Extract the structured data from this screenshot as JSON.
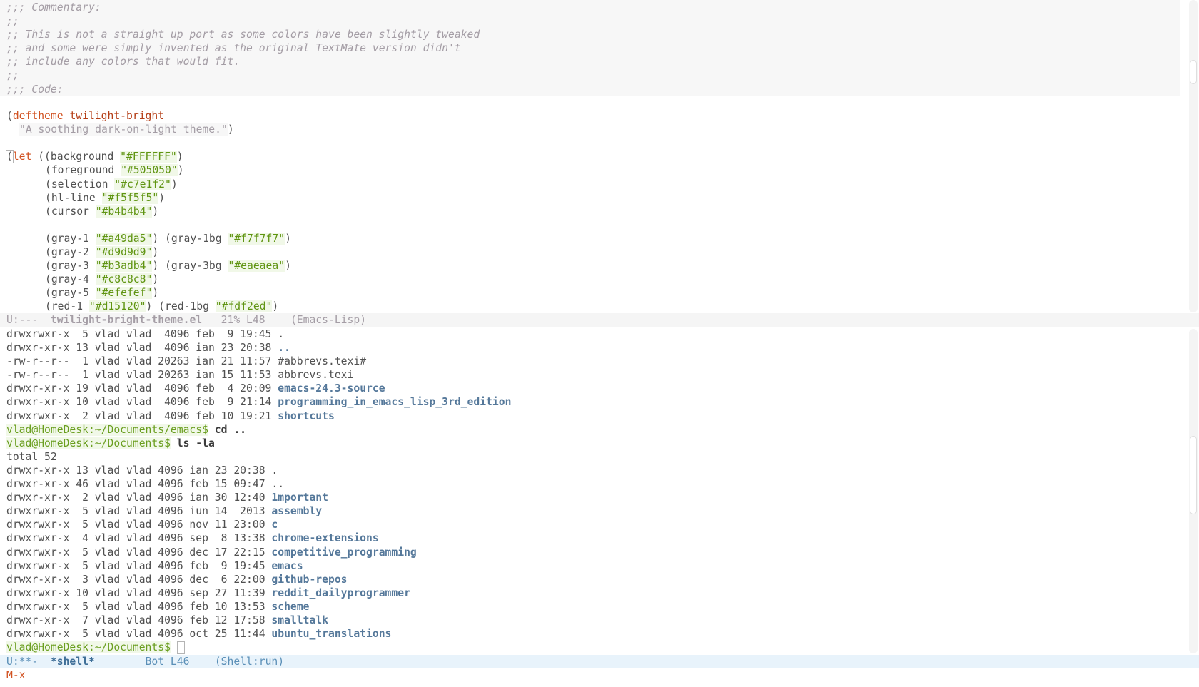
{
  "editor": {
    "commentary": [
      ";;; Commentary:",
      ";;",
      ";; This is not a straight up port as some colors have been slightly tweaked",
      ";; and some were simply invented as the original TextMate version didn't",
      ";; include any colors that would fit.",
      ";;",
      ";;; Code:"
    ],
    "deftheme": {
      "open": "(",
      "keyword": "deftheme",
      "name": "twilight-bright",
      "docstring": "\"A soothing dark-on-light theme.\"",
      "close": ")"
    },
    "let": {
      "keyword": "let",
      "bindings": [
        {
          "pre": " ((background ",
          "str": "\"#FFFFFF\"",
          "post": ")"
        },
        {
          "pre": "(foreground ",
          "str": "\"#505050\"",
          "post": ")"
        },
        {
          "pre": "(selection ",
          "str": "\"#c7e1f2\"",
          "post": ")"
        },
        {
          "pre": "(hl-line ",
          "str": "\"#f5f5f5\"",
          "post": ")"
        },
        {
          "pre": "(cursor ",
          "str": "\"#b4b4b4\"",
          "post": ")"
        }
      ],
      "grays": [
        {
          "a_pre": "(gray-1 ",
          "a_str": "\"#a49da5\"",
          "mid": ") (gray-1bg ",
          "b_str": "\"#f7f7f7\"",
          "post": ")"
        },
        {
          "a_pre": "(gray-2 ",
          "a_str": "\"#d9d9d9\"",
          "mid": ")",
          "b_str": "",
          "post": ""
        },
        {
          "a_pre": "(gray-3 ",
          "a_str": "\"#b3adb4\"",
          "mid": ") (gray-3bg ",
          "b_str": "\"#eaeaea\"",
          "post": ")"
        },
        {
          "a_pre": "(gray-4 ",
          "a_str": "\"#c8c8c8\"",
          "mid": ")",
          "b_str": "",
          "post": ""
        },
        {
          "a_pre": "(gray-5 ",
          "a_str": "\"#efefef\"",
          "mid": ")",
          "b_str": "",
          "post": ""
        },
        {
          "a_pre": "(red-1 ",
          "a_str": "\"#d15120\"",
          "mid": ") (red-1bg ",
          "b_str": "\"#fdf2ed\"",
          "post": ")"
        }
      ]
    }
  },
  "modeline_top": {
    "status": "U:---  ",
    "buffer": "twilight-bright-theme.el",
    "position": "   21% L48    ",
    "mode": "(Emacs-Lisp)"
  },
  "shell": {
    "listing1": [
      {
        "meta": "drwxrwxr-x  5 vlad vlad  4096 feb  9 19:45 ",
        "name": ".",
        "is_dir": false
      },
      {
        "meta": "drwxr-xr-x 13 vlad vlad  4096 ian 23 20:38 ",
        "name": "..",
        "is_dir": true
      },
      {
        "meta": "-rw-r--r--  1 vlad vlad 20263 ian 21 11:57 ",
        "name": "#abbrevs.texi#",
        "is_dir": false
      },
      {
        "meta": "-rw-r--r--  1 vlad vlad 20263 ian 15 11:53 ",
        "name": "abbrevs.texi",
        "is_dir": false
      },
      {
        "meta": "drwxr-xr-x 19 vlad vlad  4096 feb  4 20:09 ",
        "name": "emacs-24.3-source",
        "is_dir": true
      },
      {
        "meta": "drwxr-xr-x 10 vlad vlad  4096 feb  9 21:14 ",
        "name": "programming_in_emacs_lisp_3rd_edition",
        "is_dir": true
      },
      {
        "meta": "drwxrwxr-x  2 vlad vlad  4096 feb 10 19:21 ",
        "name": "shortcuts",
        "is_dir": true
      }
    ],
    "cmd1": {
      "prompt": "vlad@HomeDesk:~/Documents/emacs$",
      "command": " cd .."
    },
    "cmd2": {
      "prompt": "vlad@HomeDesk:~/Documents$",
      "command": " ls -la"
    },
    "total": "total 52",
    "listing2": [
      {
        "meta": "drwxr-xr-x 13 vlad vlad 4096 ian 23 20:38 ",
        "name": ".",
        "is_dir": false
      },
      {
        "meta": "drwxr-xr-x 46 vlad vlad 4096 feb 15 09:47 ",
        "name": "..",
        "is_dir": false
      },
      {
        "meta": "drwxr-xr-x  2 vlad vlad 4096 ian 30 12:40 ",
        "name": "1mportant",
        "is_dir": true
      },
      {
        "meta": "drwxrwxr-x  5 vlad vlad 4096 iun 14  2013 ",
        "name": "assembly",
        "is_dir": true
      },
      {
        "meta": "drwxrwxr-x  5 vlad vlad 4096 nov 11 23:00 ",
        "name": "c",
        "is_dir": true
      },
      {
        "meta": "drwxrwxr-x  4 vlad vlad 4096 sep  8 13:38 ",
        "name": "chrome-extensions",
        "is_dir": true
      },
      {
        "meta": "drwxrwxr-x  5 vlad vlad 4096 dec 17 22:15 ",
        "name": "competitive_programming",
        "is_dir": true
      },
      {
        "meta": "drwxrwxr-x  5 vlad vlad 4096 feb  9 19:45 ",
        "name": "emacs",
        "is_dir": true
      },
      {
        "meta": "drwxr-xr-x  3 vlad vlad 4096 dec  6 22:00 ",
        "name": "github-repos",
        "is_dir": true
      },
      {
        "meta": "drwxrwxr-x 10 vlad vlad 4096 sep 27 11:39 ",
        "name": "reddit_dailyprogrammer",
        "is_dir": true
      },
      {
        "meta": "drwxrwxr-x  5 vlad vlad 4096 feb 10 13:53 ",
        "name": "scheme",
        "is_dir": true
      },
      {
        "meta": "drwxr-xr-x  7 vlad vlad 4096 feb 12 17:58 ",
        "name": "smalltalk",
        "is_dir": true
      },
      {
        "meta": "drwxrwxr-x  5 vlad vlad 4096 oct 25 11:44 ",
        "name": "ubuntu_translations",
        "is_dir": true
      }
    ],
    "prompt_final": "vlad@HomeDesk:~/Documents$"
  },
  "modeline_bottom": {
    "status": "U:**-  ",
    "buffer": "*shell*",
    "position": "        Bot L46    ",
    "mode": "(Shell:run)"
  },
  "minibuffer": "M-x",
  "colors": {
    "background": "#FFFFFF",
    "foreground": "#505050",
    "comment": "#a49da5",
    "keyword": "#d15120",
    "string": "#5f9411",
    "directory": "#55789a",
    "prompt": "#6a9e1f"
  }
}
